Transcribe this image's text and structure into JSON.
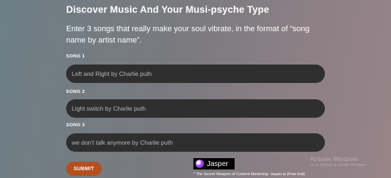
{
  "form": {
    "title": "Discover Music And Your Musi-psyche Type",
    "instructions": "Enter 3 songs that really make your soul vibrate, in the format of “song name by artist name”.",
    "songs": [
      {
        "label": "SONG 1",
        "value": "Left and Right by Charlie puth"
      },
      {
        "label": "SONG 2",
        "value": "Light switch by Charlie puth"
      },
      {
        "label": "SONG 3",
        "value": "we don't talk anymore by Charlie puth"
      }
    ],
    "submit_label": "SUBMIT"
  },
  "ad": {
    "logo_icon": "jasper-logo-icon",
    "brand": "Jasper",
    "tagline": "* The Secret Weapon of Content Marketing: Jasper.ai (Free trial)"
  },
  "watermark": {
    "title": "Activate Windows",
    "subtitle": "Go to Settings to activate Windows."
  },
  "colors": {
    "submit": "#b4501f",
    "input_bg": "#2f2f2f",
    "input_text": "#b8b8b8"
  }
}
